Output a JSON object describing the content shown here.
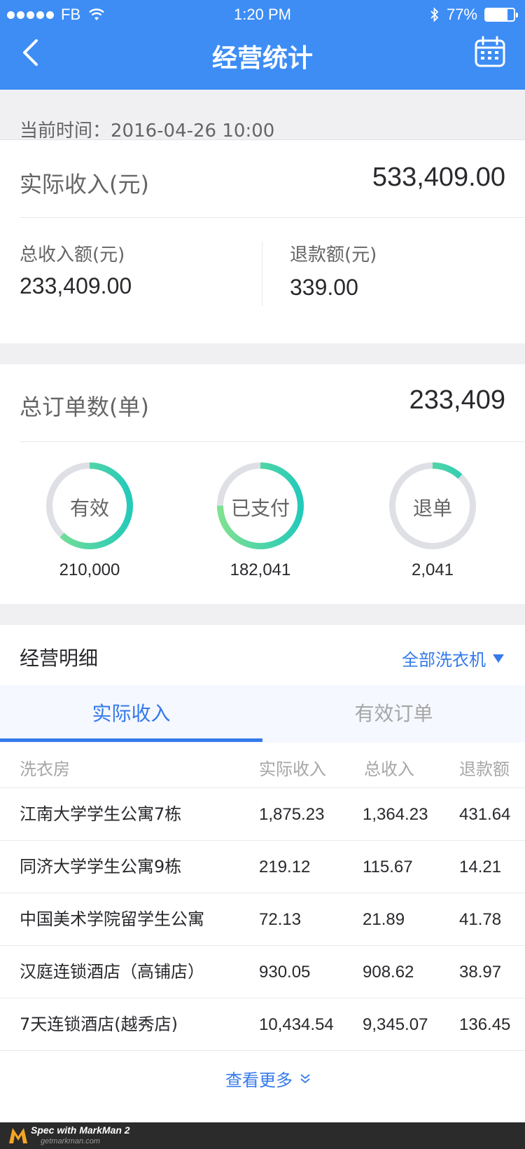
{
  "status_bar": {
    "carrier": "FB",
    "time": "1:20 PM",
    "battery": "77%",
    "battery_level": 0.77
  },
  "nav": {
    "title": "经营统计"
  },
  "current_time": {
    "text": "当前时间：2016-04-26 10:00"
  },
  "income": {
    "label": "实际收入(元)",
    "value": "533,409.00",
    "total_label": "总收入额(元)",
    "total_value": "233,409.00",
    "refund_label": "退款额(元)",
    "refund_value": "339.00"
  },
  "orders": {
    "label": "总订单数(单)",
    "value": "233,409",
    "rings": [
      {
        "label": "有效",
        "value": "210,000",
        "fraction": 0.62
      },
      {
        "label": "已支付",
        "value": "182,041",
        "fraction": 0.75
      },
      {
        "label": "退单",
        "value": "2,041",
        "fraction": 0.12
      }
    ],
    "colors": {
      "track": "#dee0e6",
      "gradient_start": "#7fe192",
      "gradient_end": "#24caba"
    }
  },
  "detail": {
    "title": "经营明细",
    "filter_label": "全部洗衣机",
    "tabs": [
      {
        "label": "实际收入",
        "active": true
      },
      {
        "label": "有效订单",
        "active": false
      }
    ],
    "columns": [
      "洗衣房",
      "实际收入",
      "总收入",
      "退款额"
    ],
    "rows": [
      [
        "江南大学学生公寓7栋",
        "1,875.23",
        "1,364.23",
        "431.64"
      ],
      [
        "同济大学学生公寓9栋",
        "219.12",
        "115.67",
        "14.21"
      ],
      [
        "中国美术学院留学生公寓",
        "72.13",
        "21.89",
        "41.78"
      ],
      [
        "汉庭连锁酒店（高铺店）",
        "930.05",
        "908.62",
        "38.97"
      ],
      [
        "7天连锁酒店(越秀店)",
        "10,434.54",
        "9,345.07",
        "136.45"
      ]
    ],
    "more_label": "查看更多"
  },
  "footer": {
    "brand_line": "Spec with MarkMan 2",
    "url": "getmarkman.com"
  },
  "colors": {
    "primary": "#347aeb",
    "header": "#3d8df5",
    "text_main": "#29292d",
    "text_sub": "#656565",
    "text_muted": "#a6a6a6",
    "divider": "#e9e9e9",
    "tab_bg": "#f5f8fe"
  }
}
